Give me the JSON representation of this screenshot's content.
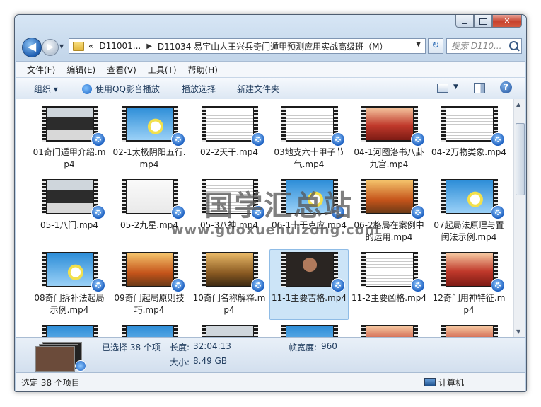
{
  "window": {
    "title_buttons": {
      "minimize": "—",
      "close": "✕"
    }
  },
  "address": {
    "back_arrow": "◀",
    "forward_arrow": "▶",
    "recent_arrow": "▼",
    "chevron": "«",
    "crumb1": "D11001...",
    "crumb2": "D11034 易宇山人王兴兵奇门遁甲预测应用实战高级班（M）",
    "sep": "▶",
    "drop": "▼",
    "refresh": "↻",
    "search_placeholder": "搜索 D110..."
  },
  "menu": [
    "文件(F)",
    "编辑(E)",
    "查看(V)",
    "工具(T)",
    "帮助(H)"
  ],
  "toolbar": {
    "organize": "组织 ▾",
    "play_qq": "使用QQ影音播放",
    "play_selection": "播放选择",
    "new_folder": "新建文件夹",
    "view_drop": "▼",
    "help": "?"
  },
  "files": [
    {
      "name": "01奇门遁甲介绍.mp4",
      "thumb": "person"
    },
    {
      "name": "02-1太极阴阳五行.mp4",
      "thumb": "daisy"
    },
    {
      "name": "02-2天干.mp4",
      "thumb": "doc"
    },
    {
      "name": "03地支六十甲子节气.mp4",
      "thumb": "doc"
    },
    {
      "name": "04-1河图洛书八卦九宫.mp4",
      "thumb": "red"
    },
    {
      "name": "04-2万物类象.mp4",
      "thumb": "doc"
    },
    {
      "name": "05-1八门.mp4",
      "thumb": "person"
    },
    {
      "name": "05-2九星.mp4",
      "thumb": "white"
    },
    {
      "name": "05-3八神.mp4",
      "thumb": "doc"
    },
    {
      "name": "06-1十干克应.mp4",
      "thumb": "daisy"
    },
    {
      "name": "06-2格局在案例中的运用.mp4",
      "thumb": "autumn"
    },
    {
      "name": "07起局法原理与置闰法示例.mp4",
      "thumb": "daisy"
    },
    {
      "name": "08奇门拆补法起局示例.mp4",
      "thumb": "daisy"
    },
    {
      "name": "09奇门起局原则技巧.mp4",
      "thumb": "autumn"
    },
    {
      "name": "10奇门名称解释.mp4",
      "thumb": "forest"
    },
    {
      "name": "11-1主要吉格.mp4",
      "thumb": "person2",
      "selected": true
    },
    {
      "name": "11-2主要凶格.mp4",
      "thumb": "doc"
    },
    {
      "name": "12奇门用神特征.mp4",
      "thumb": "red"
    },
    {
      "name": "",
      "thumb": "daisy"
    },
    {
      "name": "",
      "thumb": "daisy"
    },
    {
      "name": "",
      "thumb": "person"
    },
    {
      "name": "",
      "thumb": "daisy"
    },
    {
      "name": "",
      "thumb": "red"
    },
    {
      "name": "",
      "thumb": "red"
    }
  ],
  "watermark": {
    "line1": "国学汇总站",
    "line2": "www.guoxuehuizong.com"
  },
  "details": {
    "selected": "已选择 38 个项",
    "length_label": "长度:",
    "length": "32:04:13",
    "size_label": "大小:",
    "size": "8.49 GB",
    "frame_width_label": "帧宽度:",
    "frame_width": "960"
  },
  "status": {
    "text": "选定 38 个项目",
    "location": "计算机"
  }
}
